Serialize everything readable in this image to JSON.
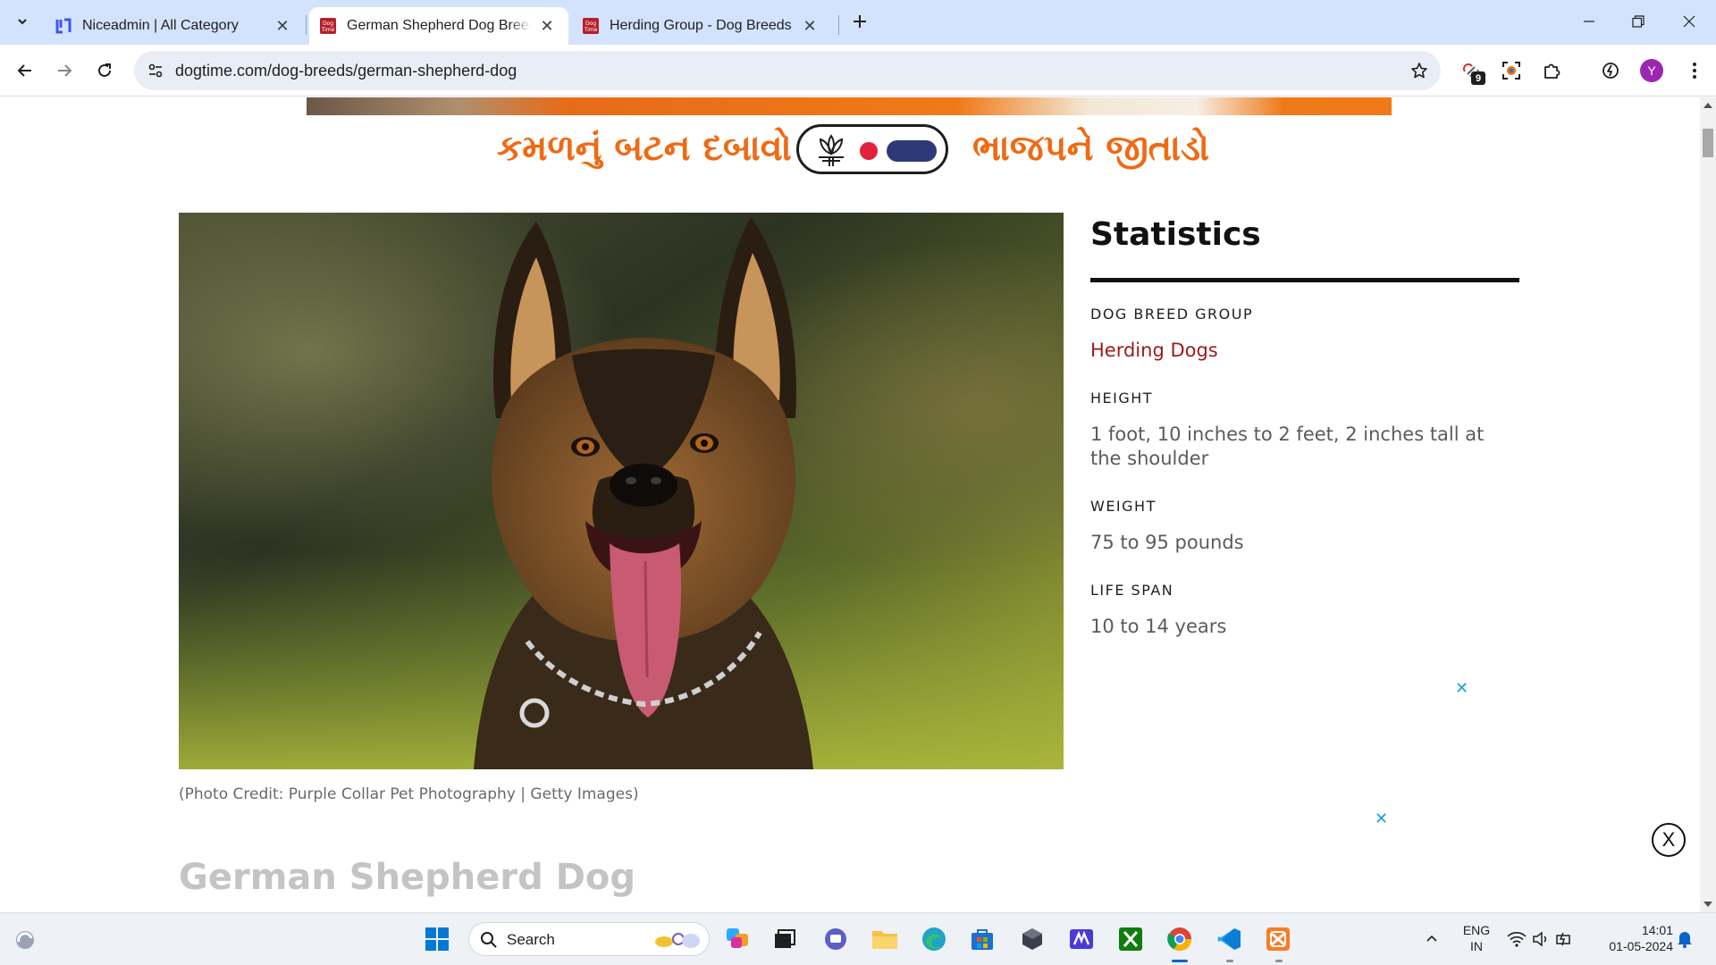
{
  "browser": {
    "tabs": [
      {
        "title": "Niceadmin | All Category",
        "active": false
      },
      {
        "title": "German Shepherd Dog Breed Information",
        "active": true
      },
      {
        "title": "Herding Group - Dog Breeds",
        "active": false
      }
    ],
    "url": "dogtime.com/dog-breeds/german-shepherd-dog",
    "profile_initial": "Y",
    "extension_badge": "9"
  },
  "ad": {
    "left_text": "કમળનું બટન દબાવો",
    "right_text": "ભાજપને જીતાડો",
    "colors": {
      "text": "#ef6a13",
      "dot": "#e5203a",
      "pill": "#2e3a78"
    }
  },
  "photo": {
    "credit": "(Photo Credit: Purple Collar Pet Photography | Getty Images)"
  },
  "statistics": {
    "title": "Statistics",
    "items": [
      {
        "label": "DOG BREED GROUP",
        "value": "Herding Dogs",
        "is_link": true
      },
      {
        "label": "HEIGHT",
        "value": "1 foot, 10 inches to 2 feet, 2 inches tall at the shoulder",
        "is_link": false
      },
      {
        "label": "WEIGHT",
        "value": "75 to 95 pounds",
        "is_link": false
      },
      {
        "label": "LIFE SPAN",
        "value": "10 to 14 years",
        "is_link": false
      }
    ]
  },
  "ad_close_symbol": "✕",
  "float_close_symbol": "X",
  "breed_heading": "German Shepherd Dog",
  "taskbar": {
    "search_label": "Search",
    "lang_primary": "ENG",
    "lang_secondary": "IN",
    "time": "14:01",
    "date": "01-05-2024"
  },
  "colors": {
    "tabstrip": "#d3e3fd",
    "link": "#9b1b1b",
    "accent_blue": "#1a9fd8"
  }
}
